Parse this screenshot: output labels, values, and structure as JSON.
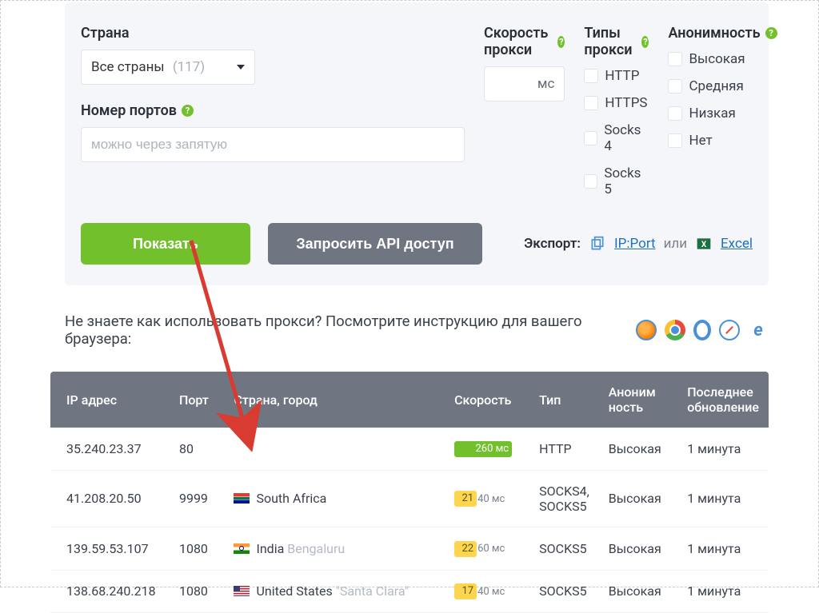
{
  "filters": {
    "country_label": "Страна",
    "country_select_prefix": "Все страны",
    "country_count": "(117)",
    "speed_label": "Скорость прокси",
    "speed_suffix": "мс",
    "ports_label": "Номер портов",
    "ports_placeholder": "можно через запятую",
    "types_label": "Типы прокси",
    "types": [
      "HTTP",
      "HTTPS",
      "Socks 4",
      "Socks 5"
    ],
    "anon_label": "Анонимность",
    "anon_levels": [
      "Высокая",
      "Средняя",
      "Низкая",
      "Нет"
    ]
  },
  "buttons": {
    "show": "Показать",
    "request_api": "Запросить API доступ"
  },
  "export": {
    "label": "Экспорт:",
    "ipport": "IP:Port",
    "or": "или",
    "excel": "Excel"
  },
  "help_text": "Не знаете как использовать прокси? Посмотрите инструкцию для вашего браузера:",
  "table": {
    "headers": {
      "ip": "IP адрес",
      "port": "Порт",
      "country": "Страна, город",
      "speed": "Скорость",
      "type": "Тип",
      "anon": "Аноним ность",
      "updated": "Последнее обновление"
    },
    "rows": [
      {
        "ip": "35.240.23.37",
        "port": "80",
        "flag": "",
        "country": "",
        "city": "",
        "speed_value": "260",
        "speed_suffix": " мс",
        "speed_style": "green",
        "speed_bar_width": "72",
        "speed_rest": "",
        "type": "HTTP",
        "anon": "Высокая",
        "updated": "1 минута"
      },
      {
        "ip": "41.208.20.50",
        "port": "9999",
        "flag": "za",
        "country": "South Africa",
        "city": "",
        "speed_value": "21",
        "speed_suffix": "",
        "speed_style": "yellow",
        "speed_bar_width": "28",
        "speed_rest": "40 мс",
        "type": "SOCKS4, SOCKS5",
        "anon": "Высокая",
        "updated": "1 минута"
      },
      {
        "ip": "139.59.53.107",
        "port": "1080",
        "flag": "in",
        "country": "India",
        "city": "Bengaluru",
        "speed_value": "22",
        "speed_suffix": "",
        "speed_style": "yellow",
        "speed_bar_width": "28",
        "speed_rest": "60 мс",
        "type": "SOCKS5",
        "anon": "Высокая",
        "updated": "1 минута"
      },
      {
        "ip": "138.68.240.218",
        "port": "1080",
        "flag": "us",
        "country": "United States",
        "city": "\"Santa Clara\"",
        "speed_value": "17",
        "speed_suffix": "",
        "speed_style": "yellow",
        "speed_bar_width": "28",
        "speed_rest": "40 мс",
        "type": "SOCKS5",
        "anon": "Высокая",
        "updated": "1 минута"
      }
    ]
  }
}
